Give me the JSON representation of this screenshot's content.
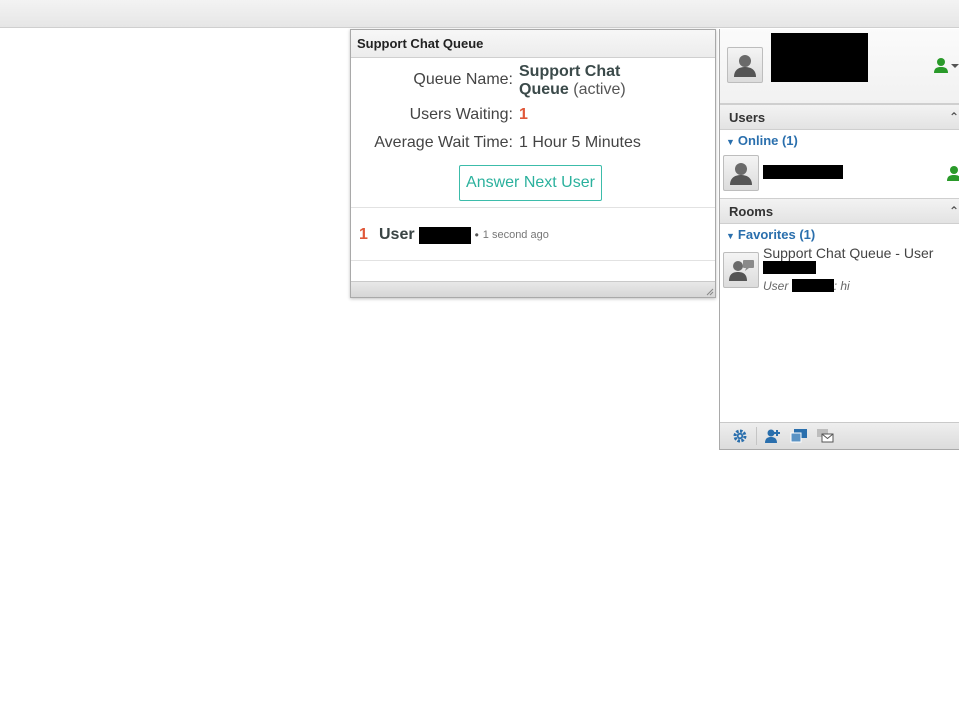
{
  "queue": {
    "title": "Support Chat Queue",
    "labels": {
      "name": "Queue Name:",
      "waiting": "Users Waiting:",
      "avg_wait": "Average Wait Time:"
    },
    "name_line1": "Support Chat",
    "name_line2": "Queue",
    "status": "(active)",
    "users_waiting": "1",
    "avg_wait": "1 Hour 5 Minutes",
    "answer_button": "Answer Next User",
    "items": [
      {
        "position": "1",
        "user_label": "User",
        "separator": "•",
        "time": "1 second ago"
      }
    ]
  },
  "sidebar": {
    "users_header": "Users",
    "online_group": "Online (1)",
    "rooms_header": "Rooms",
    "favorites_group": "Favorites (1)",
    "room": {
      "title": "Support Chat Queue - User",
      "preview_prefix": "User",
      "preview_message": ": hi"
    }
  },
  "colors": {
    "accent_teal": "#2bb19d",
    "count_red": "#e0583a",
    "link_blue": "#2a6fad",
    "presence_green": "#2a9a2a"
  },
  "icons": {
    "avatar": "person-icon",
    "presence": "user-status-icon",
    "collapse": "chevron-up-icon",
    "room": "chat-room-icon",
    "settings": "gear-icon",
    "add_contact": "add-user-icon",
    "new_room": "chat-window-icon",
    "invite": "message-icon"
  }
}
